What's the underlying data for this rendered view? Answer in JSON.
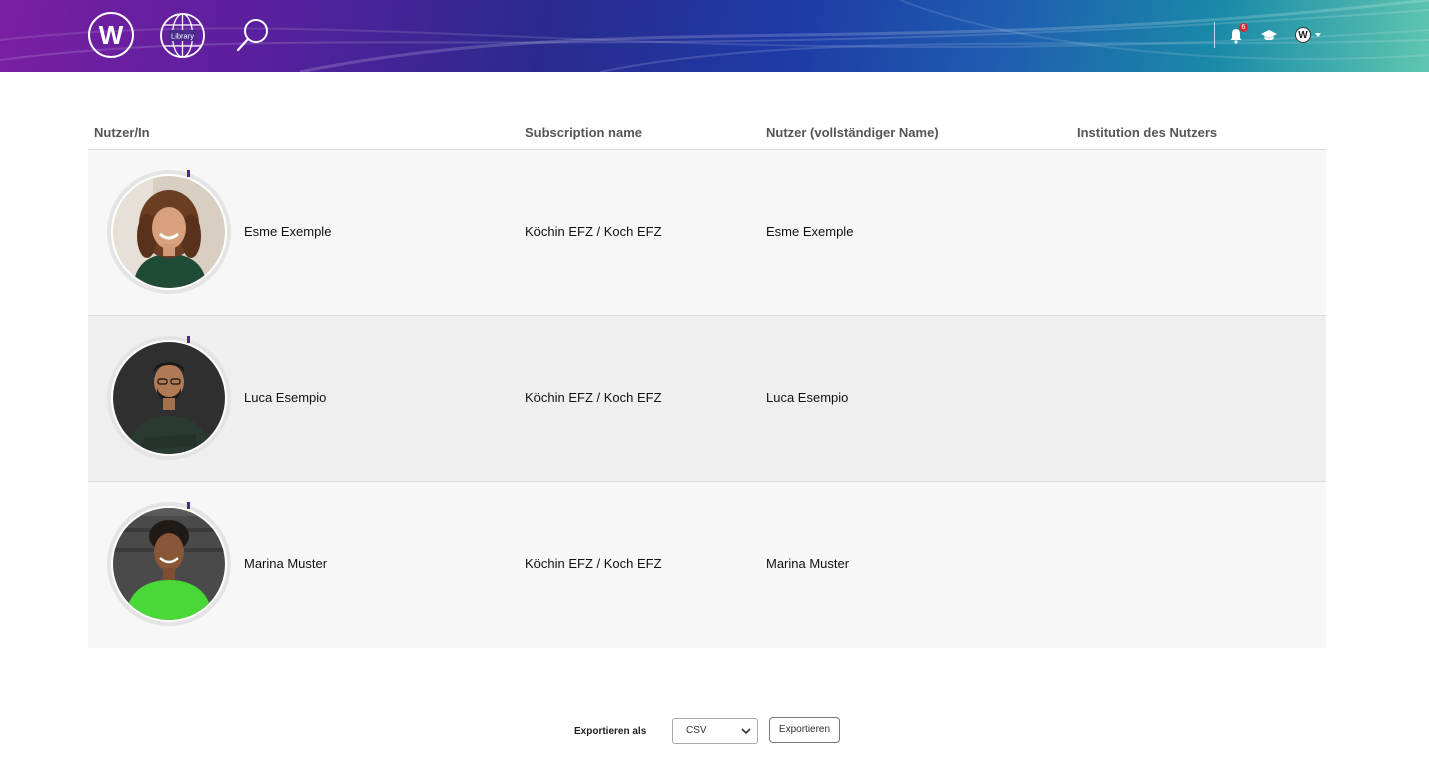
{
  "header": {
    "logo_letter": "W",
    "library_label": "Library",
    "notification_count": "6",
    "user_avatar_letter": "W"
  },
  "table": {
    "headers": {
      "user": "Nutzer/In",
      "subscription": "Subscription name",
      "full_name": "Nutzer (vollständiger Name)",
      "institution": "Institution des Nutzers"
    },
    "rows": [
      {
        "user": "Esme Exemple",
        "subscription": "Köchin EFZ / Koch EFZ",
        "full_name": "Esme Exemple",
        "institution": ""
      },
      {
        "user": "Luca Esempio",
        "subscription": "Köchin EFZ / Koch EFZ",
        "full_name": "Luca Esempio",
        "institution": ""
      },
      {
        "user": "Marina Muster",
        "subscription": "Köchin EFZ / Koch EFZ",
        "full_name": "Marina Muster",
        "institution": ""
      }
    ]
  },
  "export": {
    "label": "Exportieren als",
    "format_selected": "CSV",
    "button_label": "Exportieren"
  }
}
